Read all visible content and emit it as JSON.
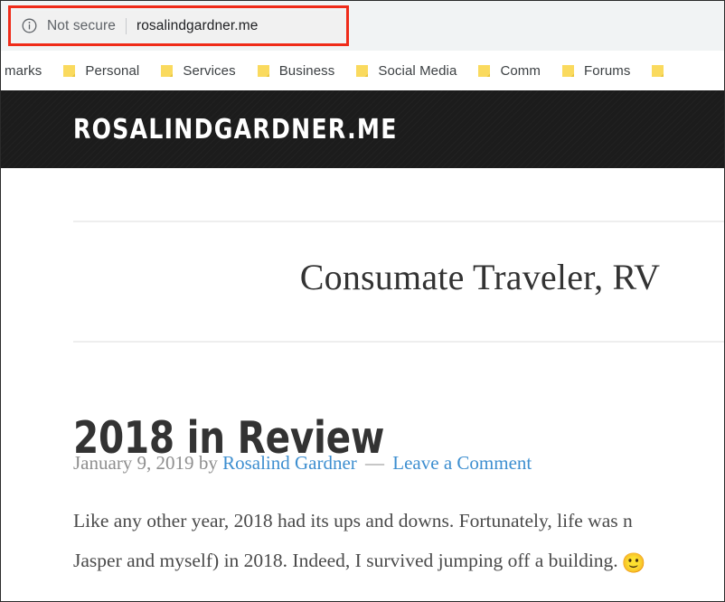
{
  "browser": {
    "omnibox": {
      "security_icon": "info-circle-icon",
      "security_label": "Not secure",
      "url": "rosalindgardner.me"
    },
    "bookmarks": [
      {
        "label": "marks",
        "icon": "folder-icon",
        "clipped": true
      },
      {
        "label": "Personal",
        "icon": "folder-icon"
      },
      {
        "label": "Services",
        "icon": "folder-icon"
      },
      {
        "label": "Business",
        "icon": "folder-icon"
      },
      {
        "label": "Social Media",
        "icon": "folder-icon"
      },
      {
        "label": "Comm",
        "icon": "folder-icon"
      },
      {
        "label": "Forums",
        "icon": "folder-icon"
      },
      {
        "label": "",
        "icon": "folder-icon"
      }
    ]
  },
  "annotation": {
    "color": "#ef2b19"
  },
  "site": {
    "title": "ROSALINDGARDNER.ME",
    "tagline": "Consumate Traveler, RV",
    "header_background": "#1c1c1c"
  },
  "post": {
    "title": "2018 in Review",
    "date": "January 9, 2019",
    "by_label": "by",
    "author": "Rosalind Gardner",
    "separator": "—",
    "comments_link": "Leave a Comment",
    "link_color": "#3e8fd0",
    "body_line_1": "Like any other year, 2018 had its ups and downs. Fortunately, life was n",
    "body_line_2": "Jasper and myself) in 2018. Indeed, I survived jumping off a building.",
    "emoji": "🙂"
  }
}
